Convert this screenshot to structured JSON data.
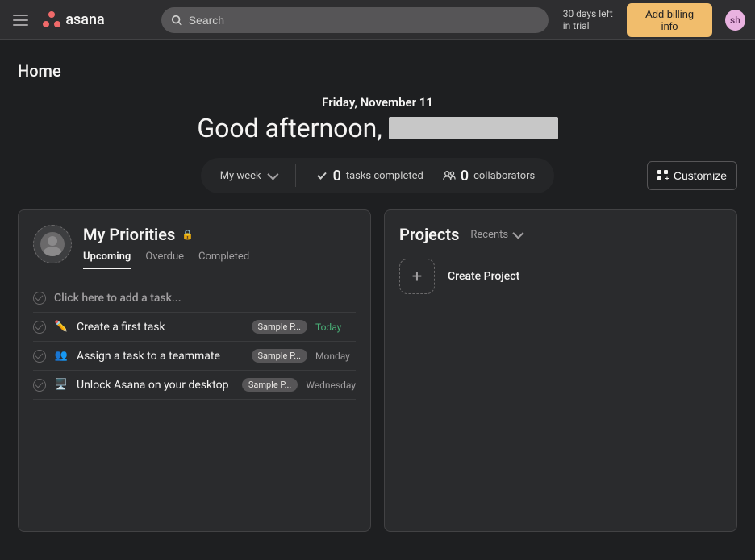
{
  "topbar": {
    "logo_text": "asana",
    "search_placeholder": "Search",
    "trial_line1": "30 days left",
    "trial_line2": "in trial",
    "billing_button": "Add billing info",
    "avatar_initials": "sh"
  },
  "page": {
    "title": "Home"
  },
  "hero": {
    "date": "Friday, November 11",
    "greeting_prefix": "Good afternoon,",
    "stats": {
      "myweek_label": "My week",
      "tasks_count": "0",
      "tasks_label": "tasks completed",
      "collab_count": "0",
      "collab_label": "collaborators"
    },
    "customize": "Customize"
  },
  "priorities": {
    "title": "My Priorities",
    "tabs": {
      "upcoming": "Upcoming",
      "overdue": "Overdue",
      "completed": "Completed"
    },
    "add_placeholder": "Click here to add a task...",
    "tasks": [
      {
        "icon": "✏️",
        "name": "Create a first task",
        "project": "Sample P...",
        "date": "Today",
        "date_class": "today"
      },
      {
        "icon": "👥",
        "name": "Assign a task to a teammate",
        "project": "Sample P...",
        "date": "Monday",
        "date_class": ""
      },
      {
        "icon": "🖥️",
        "name": "Unlock Asana on your desktop",
        "project": "Sample P...",
        "date": "Wednesday",
        "date_class": ""
      }
    ]
  },
  "projects": {
    "title": "Projects",
    "filter": "Recents",
    "create_label": "Create Project"
  }
}
